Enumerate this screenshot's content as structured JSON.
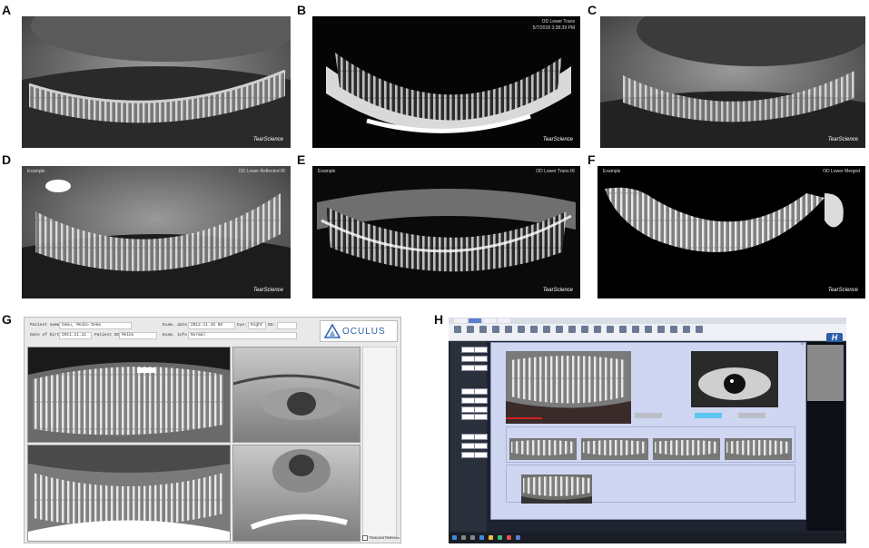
{
  "labels": [
    "A",
    "B",
    "C",
    "D",
    "E",
    "F",
    "G",
    "H"
  ],
  "brand": "TearScience",
  "captions": {
    "b_right": "OD Lower Trans",
    "b_right_date": "5/7/2018 3:38:39 PM",
    "d_left": "Example",
    "d_right": "OD Lower Reflected IR",
    "e_left": "Example",
    "e_right": "OD Lower Trans IR",
    "f_left": "Example",
    "f_right": "OD Lower Merged"
  },
  "g_form": {
    "patient_name_label": "Patient name:",
    "patient_name_value": "Gemu, Meibo Demo",
    "date_of_birth_label": "Date of birth:",
    "date_of_birth_value": "2011.11.11",
    "patient_id_label": "Patient ID:",
    "patient_id_value": "Meibo",
    "exam_date_label": "Exam. date:",
    "exam_date_value": "2012.11.16 08",
    "eye_label": "Eye:",
    "eye_value": "Right",
    "exam_info_label": "Exam. info:",
    "exam_info_value": "Normal",
    "os_label": "OS:"
  },
  "g_logo": "OCULUS",
  "g_checkbox": "Reduced Reflexes",
  "h_logo": "H"
}
